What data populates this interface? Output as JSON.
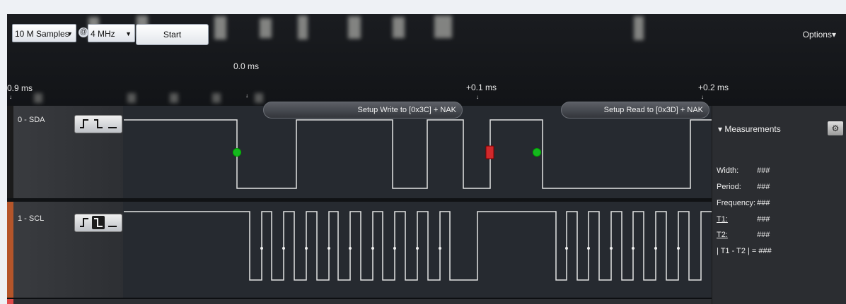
{
  "toolbar": {
    "samples": {
      "value": "10 M Samples",
      "icon": "dropdown-arrow"
    },
    "rate_prefix": "@",
    "rate": {
      "value": "4 MHz",
      "icon": "dropdown-arrow"
    },
    "start_label": "Start",
    "options_label": "Options▾"
  },
  "timeline": {
    "left_label": "0.9 ms",
    "zero_label": "0.0 ms",
    "mid_label": "+0.1 ms",
    "right_label": "+0.2 ms"
  },
  "protocol": {
    "write_label": "Setup Write to [0x3C] + NAK",
    "read_label": "Setup Read to [0x3D] + NAK"
  },
  "channels": [
    {
      "name": "0 - SDA",
      "stripe_color": "#1b1b1b"
    },
    {
      "name": "1 - SCL",
      "stripe_color": "#b4552a"
    },
    {
      "stripe_color": "#e04a4a"
    }
  ],
  "markers": {
    "start_color": "#14b81e",
    "stop_color": "#d0292b"
  },
  "measurements": {
    "title": "▾ Measurements",
    "gear_icon": "gear-icon",
    "rows": [
      {
        "label": "Width:",
        "value": "###"
      },
      {
        "label": "Period:",
        "value": "###"
      },
      {
        "label": "Frequency:",
        "value": "###"
      },
      {
        "label": "T1:",
        "value": "###"
      },
      {
        "label": "T2:",
        "value": "###"
      },
      {
        "label": "| T1 - T2 | =",
        "value": "###"
      }
    ]
  }
}
